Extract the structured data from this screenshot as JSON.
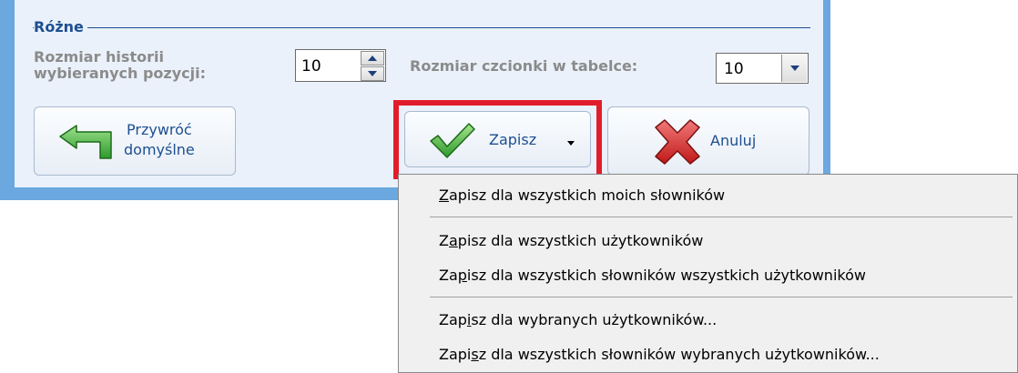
{
  "group": {
    "title": "Różne"
  },
  "history": {
    "label_line1": "Rozmiar historii",
    "label_line2": "wybieranych pozycji:",
    "value": "10"
  },
  "font_size": {
    "label": "Rozmiar czcionki w tabelce:",
    "value": "10"
  },
  "buttons": {
    "restore_line1": "Przywróć",
    "restore_line2": "domyślne",
    "save": "Zapisz",
    "cancel": "Anuluj"
  },
  "menu": {
    "items": [
      {
        "before": "",
        "key": "Z",
        "after": "apisz dla wszystkich moich słowników"
      },
      {
        "before": "Z",
        "key": "a",
        "after": "pisz dla wszystkich użytkowników"
      },
      {
        "before": "Za",
        "key": "p",
        "after": "isz dla wszystkich słowników wszystkich użytkowników"
      },
      {
        "before": "Zap",
        "key": "i",
        "after": "sz dla wybranych użytkowników..."
      },
      {
        "before": "Zapi",
        "key": "s",
        "after": "z dla wszystkich słowników wybranych użytkowników..."
      }
    ]
  },
  "colors": {
    "frame": "#6aa8df",
    "panel": "#eaf1fa",
    "highlight": "#e21d2b",
    "label_blue": "#1d4f91"
  },
  "icons": {
    "restore": "green-arrow-back-icon",
    "save": "green-checkmark-icon",
    "cancel": "red-x-icon",
    "spin_up": "triangle-up-icon",
    "spin_down": "triangle-down-icon",
    "combo": "chevron-down-icon",
    "save_dropdown": "small-down-arrow-icon"
  }
}
